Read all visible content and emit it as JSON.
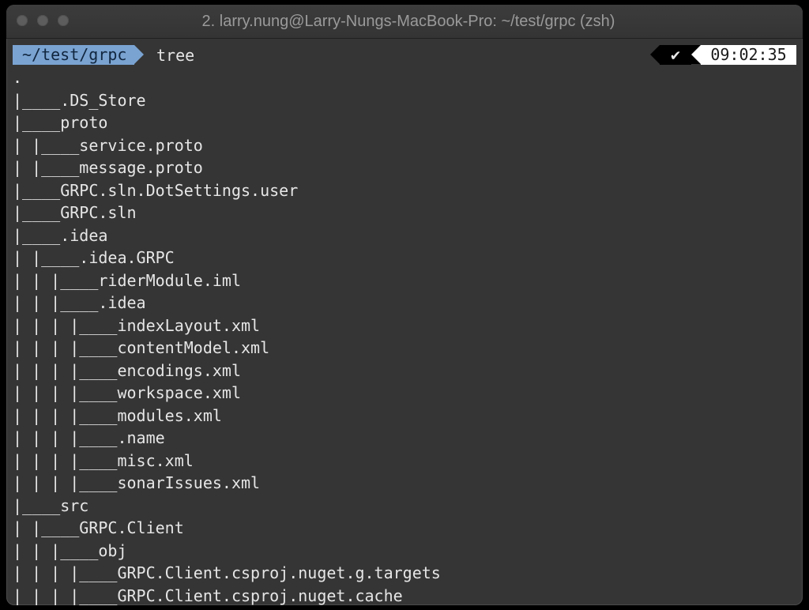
{
  "window": {
    "title": "2. larry.nung@Larry-Nungs-MacBook-Pro: ~/test/grpc (zsh)"
  },
  "prompt": {
    "cwd": "~/test/grpc",
    "command": "tree",
    "status_icon": "check-icon",
    "status_glyph": "✔",
    "time": "09:02:35"
  },
  "colors": {
    "cwd_segment": "#7aa3d1",
    "terminal_bg": "#353535",
    "text": "#e6e6e6"
  },
  "tree": [
    {
      "prefix": "",
      "name": "."
    },
    {
      "prefix": "|____",
      "name": ".DS_Store"
    },
    {
      "prefix": "|____",
      "name": "proto"
    },
    {
      "prefix": "| |____",
      "name": "service.proto"
    },
    {
      "prefix": "| |____",
      "name": "message.proto"
    },
    {
      "prefix": "|____",
      "name": "GRPC.sln.DotSettings.user"
    },
    {
      "prefix": "|____",
      "name": "GRPC.sln"
    },
    {
      "prefix": "|____",
      "name": ".idea"
    },
    {
      "prefix": "| |____",
      "name": ".idea.GRPC"
    },
    {
      "prefix": "| | |____",
      "name": "riderModule.iml"
    },
    {
      "prefix": "| | |____",
      "name": ".idea"
    },
    {
      "prefix": "| | | |____",
      "name": "indexLayout.xml"
    },
    {
      "prefix": "| | | |____",
      "name": "contentModel.xml"
    },
    {
      "prefix": "| | | |____",
      "name": "encodings.xml"
    },
    {
      "prefix": "| | | |____",
      "name": "workspace.xml"
    },
    {
      "prefix": "| | | |____",
      "name": "modules.xml"
    },
    {
      "prefix": "| | | |____",
      "name": ".name"
    },
    {
      "prefix": "| | | |____",
      "name": "misc.xml"
    },
    {
      "prefix": "| | | |____",
      "name": "sonarIssues.xml"
    },
    {
      "prefix": "|____",
      "name": "src"
    },
    {
      "prefix": "| |____",
      "name": "GRPC.Client"
    },
    {
      "prefix": "| | |____",
      "name": "obj"
    },
    {
      "prefix": "| | | |____",
      "name": "GRPC.Client.csproj.nuget.g.targets"
    },
    {
      "prefix": "| | | |____",
      "name": "GRPC.Client.csproj.nuget.cache"
    }
  ]
}
